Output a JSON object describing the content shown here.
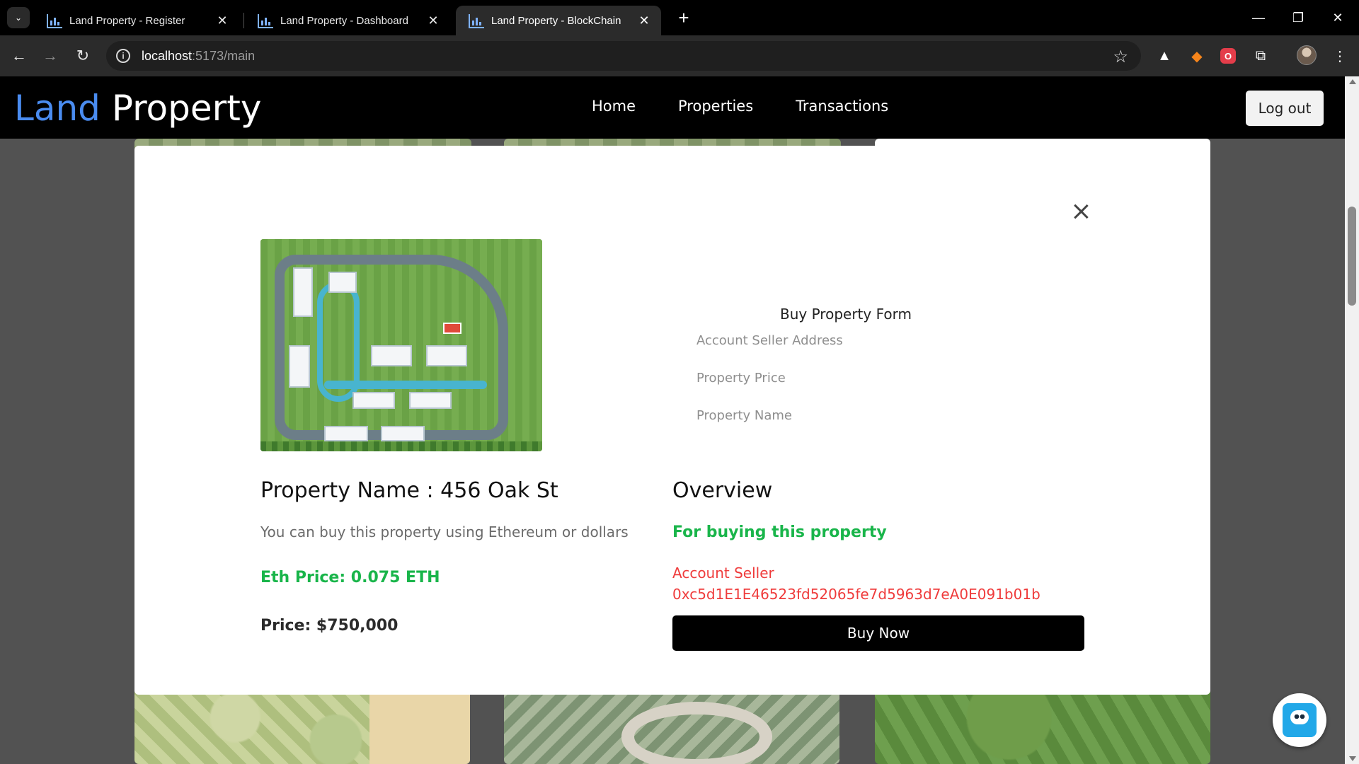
{
  "browser": {
    "tabs": [
      {
        "title": "Land Property - Register",
        "active": false
      },
      {
        "title": "Land Property - Dashboard",
        "active": false
      },
      {
        "title": "Land Property - BlockChain",
        "active": true
      }
    ],
    "url_host": "localhost",
    "url_rest": ":5173/main"
  },
  "site": {
    "logo_part1": "Land",
    "logo_part2": " Property",
    "nav": [
      "Home",
      "Properties",
      "Transactions"
    ],
    "logout_label": "Log out",
    "brand_color": "#4a8cf0"
  },
  "modal": {
    "property_title": "Property Name : 456 Oak St",
    "description": "You can buy this property using Ethereum or dollars",
    "eth_price": "Eth Price: 0.075 ETH",
    "usd_price": "Price: $750,000",
    "form": {
      "title": "Buy Property Form",
      "seller_placeholder": "Account Seller Address",
      "price_placeholder": "Property Price",
      "name_placeholder": "Property Name"
    },
    "overview": {
      "title": "Overview",
      "subtitle": "For buying this property",
      "seller_label": "Account Seller",
      "seller_address": "0xc5d1E1E46523fd52065fe7d5963d7eA0E091b01b"
    },
    "buy_label": "Buy Now"
  },
  "colors": {
    "green": "#19b54a",
    "red": "#ef3b3b"
  }
}
